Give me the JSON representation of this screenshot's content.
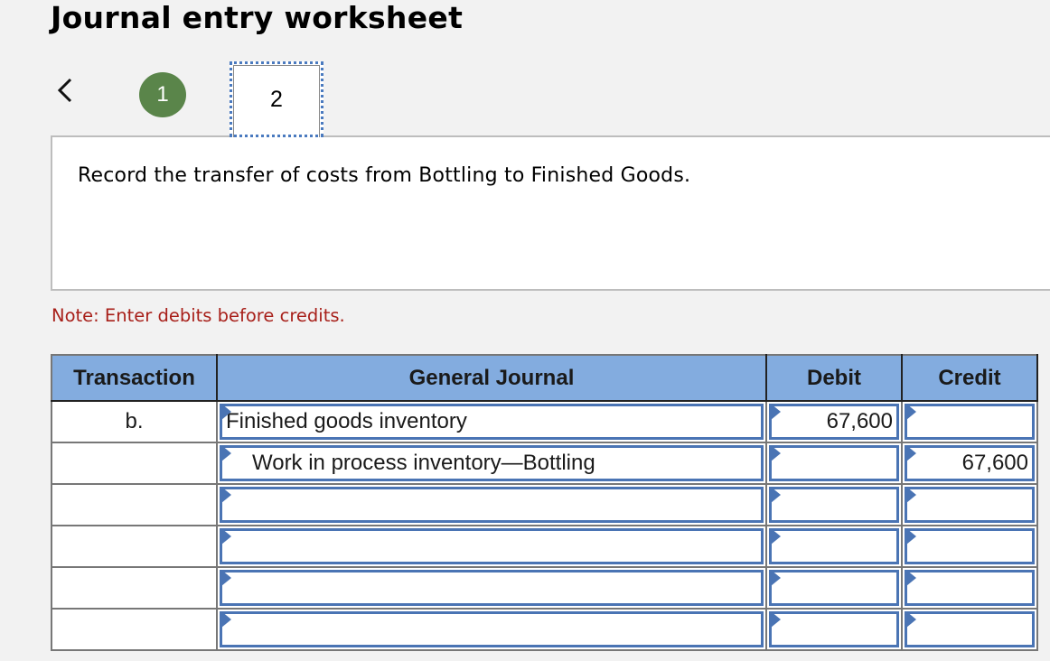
{
  "page": {
    "title": "Journal entry worksheet"
  },
  "navigation": {
    "prev_icon": "chevron-left-icon",
    "steps": [
      {
        "label": "1",
        "state": "completed",
        "color": "#5a854a"
      },
      {
        "label": "2",
        "state": "current"
      }
    ]
  },
  "prompt": {
    "text": "Record the transfer of costs from Bottling to Finished Goods."
  },
  "note": {
    "text": "Note: Enter debits before credits.",
    "color": "#a8201a"
  },
  "journal_table": {
    "header_color": "#83acdf",
    "columns": [
      "Transaction",
      "General Journal",
      "Debit",
      "Credit"
    ],
    "rows": [
      {
        "transaction": "b.",
        "account": "Finished goods inventory",
        "debit": "67,600",
        "credit": "",
        "indent": false
      },
      {
        "transaction": "",
        "account": "Work in process inventory—Bottling",
        "debit": "",
        "credit": "67,600",
        "indent": true
      },
      {
        "transaction": "",
        "account": "",
        "debit": "",
        "credit": "",
        "indent": false
      },
      {
        "transaction": "",
        "account": "",
        "debit": "",
        "credit": "",
        "indent": false
      },
      {
        "transaction": "",
        "account": "",
        "debit": "",
        "credit": "",
        "indent": false
      },
      {
        "transaction": "",
        "account": "",
        "debit": "",
        "credit": "",
        "indent": false
      }
    ]
  }
}
